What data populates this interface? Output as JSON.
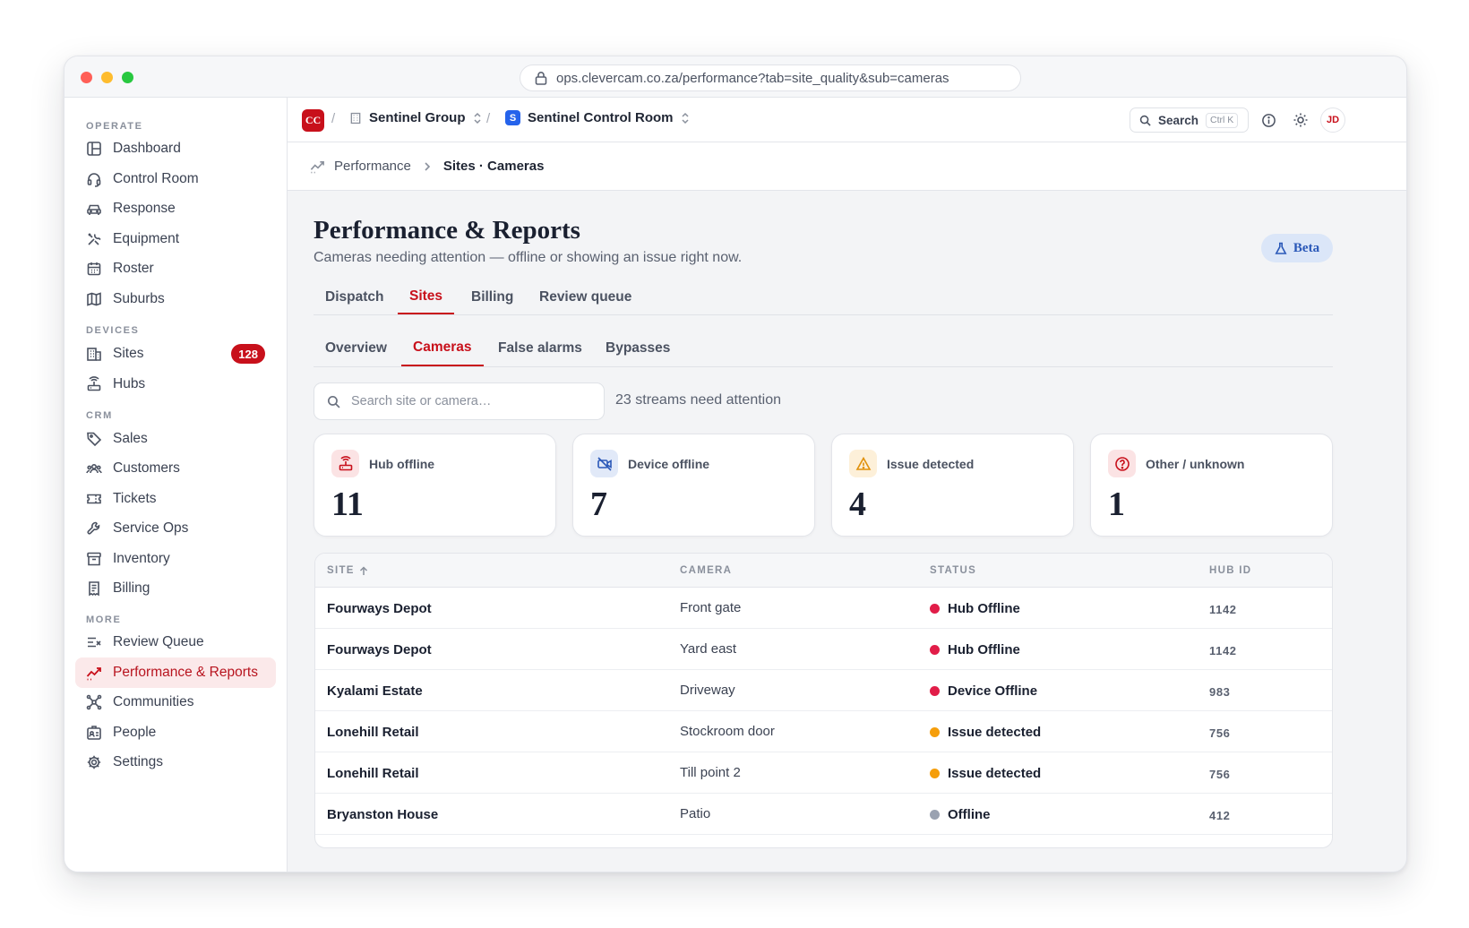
{
  "browser": {
    "url": "ops.clevercam.co.za/performance?tab=site_quality&sub=cameras"
  },
  "sidebar": {
    "sections": [
      {
        "label": "OPERATE",
        "items": [
          {
            "label": "Dashboard",
            "icon": "layout-icon"
          },
          {
            "label": "Control Room",
            "icon": "headset-icon"
          },
          {
            "label": "Response",
            "icon": "car-icon"
          },
          {
            "label": "Equipment",
            "icon": "tools-icon"
          },
          {
            "label": "Roster",
            "icon": "calendar-icon"
          },
          {
            "label": "Suburbs",
            "icon": "map-icon"
          }
        ]
      },
      {
        "label": "DEVICES",
        "items": [
          {
            "label": "Sites",
            "icon": "building-icon",
            "badge": "128"
          },
          {
            "label": "Hubs",
            "icon": "router-icon"
          }
        ]
      },
      {
        "label": "CRM",
        "items": [
          {
            "label": "Sales",
            "icon": "tag-icon"
          },
          {
            "label": "Customers",
            "icon": "users-icon"
          },
          {
            "label": "Tickets",
            "icon": "ticket-icon"
          },
          {
            "label": "Service Ops",
            "icon": "wrench-icon"
          },
          {
            "label": "Inventory",
            "icon": "archive-icon"
          },
          {
            "label": "Billing",
            "icon": "receipt-icon"
          }
        ]
      },
      {
        "label": "MORE",
        "items": [
          {
            "label": "Review Queue",
            "icon": "list-check-icon"
          },
          {
            "label": "Performance & Reports",
            "icon": "trend-icon",
            "active": true
          },
          {
            "label": "Communities",
            "icon": "network-icon"
          },
          {
            "label": "People",
            "icon": "id-badge-icon"
          },
          {
            "label": "Settings",
            "icon": "gear-icon"
          }
        ]
      }
    ]
  },
  "topbar": {
    "logo": "CC",
    "org": "Sentinel Group",
    "workspace_logo": "S",
    "workspace": "Sentinel Control Room",
    "search_label": "Search",
    "search_shortcut": "Ctrl K",
    "avatar": "JD"
  },
  "breadcrumb": {
    "parent": "Performance",
    "current": "Sites · Cameras"
  },
  "page": {
    "title": "Performance & Reports",
    "subtitle": "Cameras needing attention — offline or showing an issue right now.",
    "beta": "Beta"
  },
  "tabs": [
    "Dispatch",
    "Sites",
    "Billing",
    "Review queue"
  ],
  "active_tab": "Sites",
  "subtabs": [
    "Overview",
    "Cameras",
    "False alarms",
    "Bypasses"
  ],
  "active_subtab": "Cameras",
  "search": {
    "placeholder": "Search site or camera…"
  },
  "attention_text": "23 streams need attention",
  "cards": [
    {
      "label": "Hub offline",
      "value": "11",
      "icon": "router-icon",
      "color": "#c8101b",
      "bg": "#fbe3e4"
    },
    {
      "label": "Device offline",
      "value": "7",
      "icon": "video-off-icon",
      "color": "#2a58b8",
      "bg": "#e1e9f8"
    },
    {
      "label": "Issue detected",
      "value": "4",
      "icon": "warning-icon",
      "color": "#e0900a",
      "bg": "#fdf0d9"
    },
    {
      "label": "Other / unknown",
      "value": "1",
      "icon": "question-icon",
      "color": "#c8101b",
      "bg": "#fbe3e4"
    }
  ],
  "table": {
    "headers": {
      "site": "SITE",
      "camera": "CAMERA",
      "status": "STATUS",
      "hub": "HUB ID"
    },
    "rows": [
      {
        "site": "Fourways Depot",
        "camera": "Front gate",
        "status": "Hub Offline",
        "hub": "1142",
        "dot": "#e11d48"
      },
      {
        "site": "Fourways Depot",
        "camera": "Yard east",
        "status": "Hub Offline",
        "hub": "1142",
        "dot": "#e11d48"
      },
      {
        "site": "Kyalami Estate",
        "camera": "Driveway",
        "status": "Device Offline",
        "hub": "983",
        "dot": "#e11d48"
      },
      {
        "site": "Lonehill Retail",
        "camera": "Stockroom door",
        "status": "Issue detected",
        "hub": "756",
        "dot": "#f59e0b"
      },
      {
        "site": "Lonehill Retail",
        "camera": "Till point 2",
        "status": "Issue detected",
        "hub": "756",
        "dot": "#f59e0b"
      },
      {
        "site": "Bryanston House",
        "camera": "Patio",
        "status": "Offline",
        "hub": "412",
        "dot": "#9aa2b1"
      }
    ]
  }
}
